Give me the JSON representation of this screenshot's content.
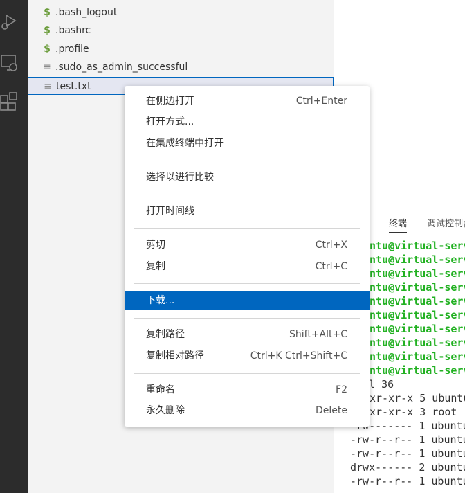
{
  "activity_bar": {
    "icons": [
      "run-debug-icon",
      "remote-explorer-icon",
      "extensions-icon"
    ]
  },
  "explorer": {
    "files": [
      {
        "name": ".bash_logout",
        "icon": "shell-dollar-icon",
        "glyph": "$"
      },
      {
        "name": ".bashrc",
        "icon": "shell-dollar-icon",
        "glyph": "$"
      },
      {
        "name": ".profile",
        "icon": "shell-dollar-icon",
        "glyph": "$"
      },
      {
        "name": ".sudo_as_admin_successful",
        "icon": "text-file-icon",
        "glyph": "≡"
      },
      {
        "name": "test.txt",
        "icon": "text-file-icon",
        "glyph": "≡",
        "selected": true
      }
    ]
  },
  "context_menu": {
    "items": [
      {
        "label": "在侧边打开",
        "shortcut": "Ctrl+Enter"
      },
      {
        "label": "打开方式...",
        "shortcut": ""
      },
      {
        "label": "在集成终端中打开",
        "shortcut": ""
      },
      {
        "label": "选择以进行比较",
        "shortcut": ""
      },
      {
        "label": "打开时间线",
        "shortcut": ""
      },
      {
        "label": "剪切",
        "shortcut": "Ctrl+X"
      },
      {
        "label": "复制",
        "shortcut": "Ctrl+C"
      },
      {
        "label": "下载...",
        "shortcut": "",
        "highlighted": true
      },
      {
        "label": "复制路径",
        "shortcut": "Shift+Alt+C"
      },
      {
        "label": "复制相对路径",
        "shortcut": "Ctrl+K Ctrl+Shift+C"
      },
      {
        "label": "重命名",
        "shortcut": "F2"
      },
      {
        "label": "永久删除",
        "shortcut": "Delete"
      }
    ]
  },
  "panel": {
    "tabs": [
      "终端",
      "调试控制台"
    ],
    "active_tab": "终端",
    "terminal_lines": [
      "ntu@virtual-serv",
      "ntu@virtual-serv",
      "ntu@virtual-serv",
      "ntu@virtual-serv",
      "ntu@virtual-serv",
      "ntu@virtual-serv",
      "ntu@virtual-serv",
      "ntu@virtual-serv",
      "ntu@virtual-serv",
      "ntu@virtual-serv",
      "al 36",
      "xr-xr-x 5 ubuntu",
      "xr-xr-x 3 root",
      "-rw------- 1 ubuntu",
      "-rw-r--r-- 1 ubuntu",
      "-rw-r--r-- 1 ubuntu",
      "drwx------ 2 ubuntu",
      "-rw-r--r-- 1 ubuntu"
    ]
  },
  "colors": {
    "activity_bar": "#2c2c2c",
    "sidebar": "#f3f3f3",
    "highlight": "#0066bf",
    "prompt_green": "#22b122",
    "shell_icon": "#6a9c3a"
  }
}
